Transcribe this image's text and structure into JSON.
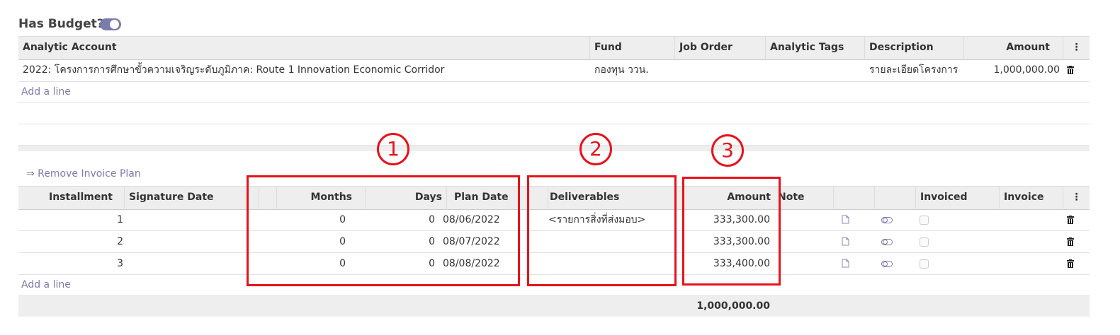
{
  "budget": {
    "label": "Has Budget?",
    "enabled": true
  },
  "analytic_table": {
    "headers": {
      "account": "Analytic Account",
      "fund": "Fund",
      "job_order": "Job Order",
      "tags": "Analytic Tags",
      "description": "Description",
      "amount": "Amount"
    },
    "rows": [
      {
        "account": "2022: โครงการการศึกษาขั้วความเจริญระดับภูมิภาค: Route 1 Innovation Economic Corridor",
        "fund": "กองทุน ววน.",
        "job_order": "",
        "tags": "",
        "description": "รายละเอียดโครงการ",
        "amount": "1,000,000.00"
      }
    ],
    "add_line": "Add a line"
  },
  "invoice_plan": {
    "remove_link": "⇒ Remove Invoice Plan",
    "headers": {
      "installment": "Installment",
      "signature_date": "Signature Date",
      "months": "Months",
      "days": "Days",
      "plan_date": "Plan Date",
      "deliverables": "Deliverables",
      "amount": "Amount",
      "note": "Note",
      "invoiced": "Invoiced",
      "invoice": "Invoice"
    },
    "rows": [
      {
        "installment": "1",
        "months": "0",
        "days": "0",
        "plan_date": "08/06/2022",
        "deliverables": "<รายการสิ่งที่ส่งมอบ>",
        "amount": "333,300.00"
      },
      {
        "installment": "2",
        "months": "0",
        "days": "0",
        "plan_date": "08/07/2022",
        "deliverables": "",
        "amount": "333,300.00"
      },
      {
        "installment": "3",
        "months": "0",
        "days": "0",
        "plan_date": "08/08/2022",
        "deliverables": "",
        "amount": "333,400.00"
      }
    ],
    "add_line": "Add a line",
    "total": "1,000,000.00"
  },
  "callouts": [
    "1",
    "2",
    "3"
  ],
  "colors": {
    "accent": "#7c7bad",
    "annotation": "#e8121a",
    "header_bg": "#eeeeee"
  }
}
